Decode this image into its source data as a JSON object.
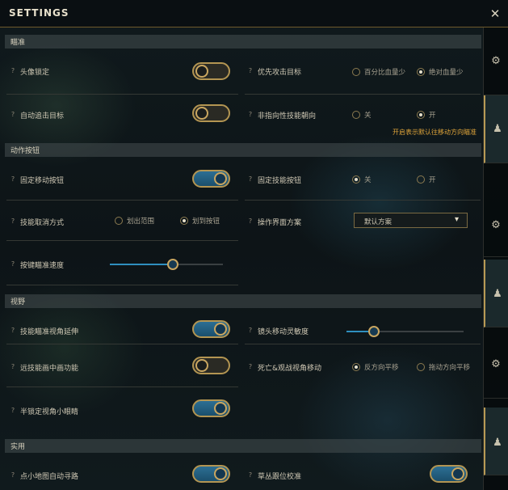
{
  "title": "SETTINGS",
  "close_glyph": "✕",
  "sidebar": {
    "tabs": [
      {
        "icon": "gear-icon",
        "glyph": "⚙",
        "active": false
      },
      {
        "icon": "user-icon",
        "glyph": "♟",
        "active": true
      },
      {
        "icon": "gear-icon",
        "glyph": "⚙",
        "active": false
      },
      {
        "icon": "user-icon",
        "glyph": "♟",
        "active": true
      },
      {
        "icon": "gear-icon",
        "glyph": "⚙",
        "active": false
      },
      {
        "icon": "user-icon",
        "glyph": "♟",
        "active": true
      }
    ]
  },
  "help_glyph": "?",
  "sections": {
    "aim": {
      "title": "瞄准",
      "head_lock": {
        "label": "头像锁定",
        "on": false
      },
      "priority_target": {
        "label": "优先攻击目标",
        "options": [
          "百分比血量少",
          "绝对血量少"
        ],
        "selected": "绝对血量少"
      },
      "auto_chase": {
        "label": "自动追击目标",
        "on": false
      },
      "skill_direction": {
        "label": "非指向性技能朝向",
        "options": [
          "关",
          "开"
        ],
        "selected": "开",
        "tooltip": "开启表示默认往移动方向瞄准"
      }
    },
    "action_buttons": {
      "title": "动作按钮",
      "fixed_move_button": {
        "label": "固定移动按钮",
        "on": true
      },
      "fixed_skill_button": {
        "label": "固定技能按钮",
        "options": [
          "关",
          "开"
        ],
        "selected": "关"
      },
      "skill_cancel": {
        "label": "技能取消方式",
        "options": [
          "划出范围",
          "划到按钮"
        ],
        "selected": "划到按钮"
      },
      "ui_scheme": {
        "label": "操作界面方案",
        "value": "默认方案",
        "arrow": "▾"
      },
      "button_aim_speed": {
        "label": "按键瞄准速度",
        "level": 0.56
      }
    },
    "view": {
      "title": "视野",
      "skill_aim_extend": {
        "label": "技能瞄准视角延伸",
        "on": true
      },
      "camera_sensitivity": {
        "label": "镜头移动灵敏度",
        "level": 0.23
      },
      "remote_skill_pip": {
        "label": "远技能画中画功能",
        "on": false
      },
      "death_spectate": {
        "label": "死亡&观战视角移动",
        "options": [
          "反方向平移",
          "拖动方向平移"
        ],
        "selected": "反方向平移"
      },
      "half_lock_eye": {
        "label": "半锁定视角小眼睛",
        "on": true
      }
    },
    "utility": {
      "title": "实用",
      "minimap_autopath": {
        "label": "点小地图自动寻路",
        "on": true
      },
      "bush_calibration": {
        "label": "草丛跟位校准",
        "on": true
      }
    }
  }
}
